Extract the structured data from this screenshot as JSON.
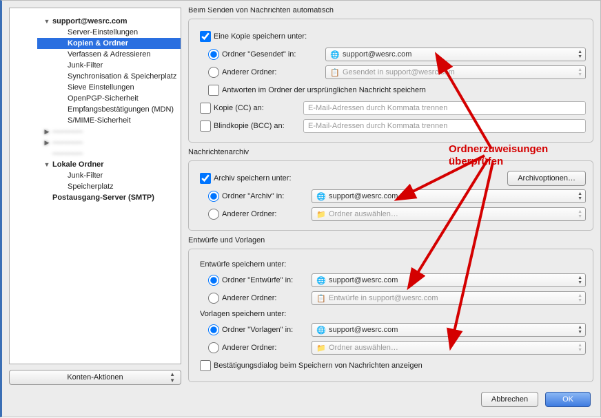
{
  "sidebar": {
    "accounts_button": "Konten-Aktionen",
    "nodes": [
      {
        "label": "support@wesrc.com",
        "depth": 0,
        "tw": "▼",
        "acct": true
      },
      {
        "label": "Server-Einstellungen",
        "depth": 1
      },
      {
        "label": "Kopien & Ordner",
        "depth": 1,
        "sel": true
      },
      {
        "label": "Verfassen & Adressieren",
        "depth": 1
      },
      {
        "label": "Junk-Filter",
        "depth": 1
      },
      {
        "label": "Synchronisation & Speicherplatz",
        "depth": 1
      },
      {
        "label": "Sieve Einstellungen",
        "depth": 1
      },
      {
        "label": "OpenPGP-Sicherheit",
        "depth": 1
      },
      {
        "label": "Empfangsbestätigungen (MDN)",
        "depth": 1
      },
      {
        "label": "S/MIME-Sicherheit",
        "depth": 1
      },
      {
        "label": "————",
        "depth": 0,
        "tw": "▶",
        "blur": true
      },
      {
        "label": "————",
        "depth": 0,
        "tw": "▶",
        "blur": true
      },
      {
        "label": "————",
        "depth": 0,
        "blur": true
      },
      {
        "label": "Lokale Ordner",
        "depth": 0,
        "tw": "▼",
        "acct": true
      },
      {
        "label": "Junk-Filter",
        "depth": 1
      },
      {
        "label": "Speicherplatz",
        "depth": 1
      },
      {
        "label": "Postausgang-Server (SMTP)",
        "depth": 0,
        "acct": true
      }
    ]
  },
  "send": {
    "legend": "Beim Senden von Nachrichten automatisch",
    "save_copy": "Eine Kopie speichern unter:",
    "folder_sent": "Ordner \"Gesendet\" in:",
    "sent_value": "support@wesrc.com",
    "other_folder": "Anderer Ordner:",
    "other_value": "Gesendet in support@wesrc.com",
    "reply_in_orig": "Antworten im Ordner der ursprünglichen Nachricht speichern",
    "cc": "Kopie (CC) an:",
    "bcc": "Blindkopie (BCC) an:",
    "addr_placeholder": "E-Mail-Adressen durch Kommata trennen"
  },
  "archive": {
    "legend": "Nachrichtenarchiv",
    "save": "Archiv speichern unter:",
    "folder": "Ordner \"Archiv\" in:",
    "value": "support@wesrc.com",
    "other": "Anderer Ordner:",
    "other_value": "Ordner auswählen…",
    "options_btn": "Archivoptionen…"
  },
  "drafts": {
    "legend": "Entwürfe und Vorlagen",
    "drafts_head": "Entwürfe speichern unter:",
    "drafts_folder": "Ordner \"Entwürfe\" in:",
    "drafts_value": "support@wesrc.com",
    "drafts_other": "Anderer Ordner:",
    "drafts_other_value": "Entwürfe in support@wesrc.com",
    "templates_head": "Vorlagen speichern unter:",
    "templates_folder": "Ordner \"Vorlagen\" in:",
    "templates_value": "support@wesrc.com",
    "templates_other": "Anderer Ordner:",
    "templates_other_value": "Ordner auswählen…",
    "confirm": "Bestätigungsdialog beim Speichern von Nachrichten anzeigen"
  },
  "footer": {
    "cancel": "Abbrechen",
    "ok": "OK"
  },
  "annotation": {
    "text": "Ordnerzuweisungen\nüberprüfen"
  }
}
